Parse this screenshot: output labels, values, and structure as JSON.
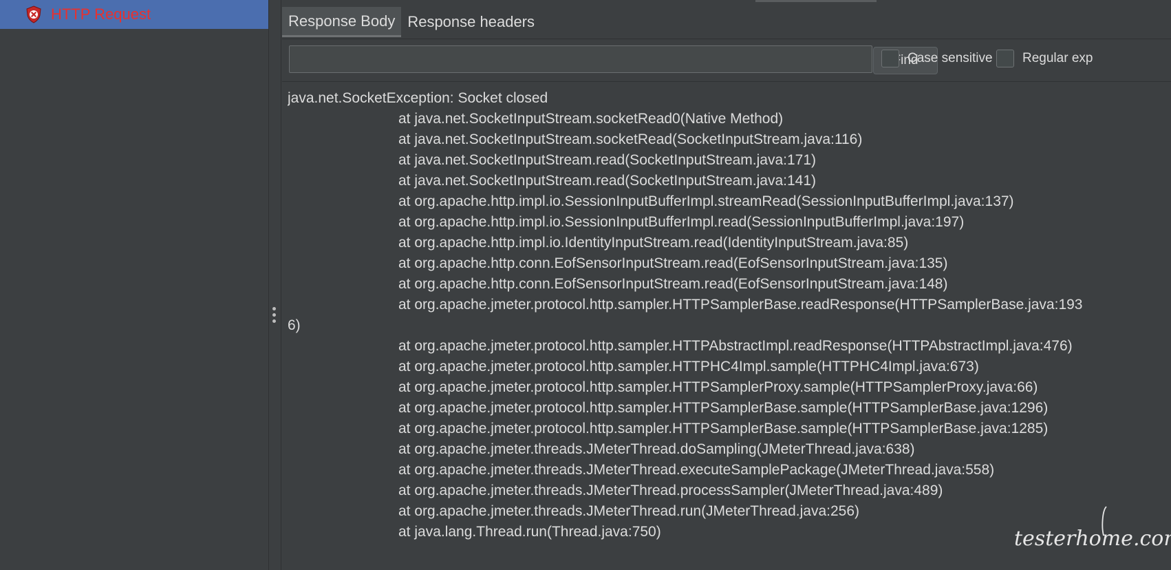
{
  "tree": {
    "selected_item": {
      "label": "HTTP Request",
      "icon": "error-shield-icon",
      "color": "#e8312f"
    }
  },
  "tabs": [
    {
      "label": "Response Body",
      "active": true
    },
    {
      "label": "Response headers",
      "active": false
    }
  ],
  "search": {
    "value": "",
    "find_label": "Find",
    "case_sensitive_label": "Case sensitive",
    "regex_label": "Regular exp",
    "case_sensitive_checked": false,
    "regex_checked": false
  },
  "response_body": {
    "lines": [
      {
        "text": "java.net.SocketException: Socket closed",
        "indent": false
      },
      {
        "text": "at java.net.SocketInputStream.socketRead0(Native Method)",
        "indent": true
      },
      {
        "text": "at java.net.SocketInputStream.socketRead(SocketInputStream.java:116)",
        "indent": true
      },
      {
        "text": "at java.net.SocketInputStream.read(SocketInputStream.java:171)",
        "indent": true
      },
      {
        "text": "at java.net.SocketInputStream.read(SocketInputStream.java:141)",
        "indent": true
      },
      {
        "text": "at org.apache.http.impl.io.SessionInputBufferImpl.streamRead(SessionInputBufferImpl.java:137)",
        "indent": true
      },
      {
        "text": "at org.apache.http.impl.io.SessionInputBufferImpl.read(SessionInputBufferImpl.java:197)",
        "indent": true
      },
      {
        "text": "at org.apache.http.impl.io.IdentityInputStream.read(IdentityInputStream.java:85)",
        "indent": true
      },
      {
        "text": "at org.apache.http.conn.EofSensorInputStream.read(EofSensorInputStream.java:135)",
        "indent": true
      },
      {
        "text": "at org.apache.http.conn.EofSensorInputStream.read(EofSensorInputStream.java:148)",
        "indent": true
      },
      {
        "text": "at org.apache.jmeter.protocol.http.sampler.HTTPSamplerBase.readResponse(HTTPSamplerBase.java:193",
        "indent": true
      },
      {
        "text": "6)",
        "indent": false
      },
      {
        "text": "at org.apache.jmeter.protocol.http.sampler.HTTPAbstractImpl.readResponse(HTTPAbstractImpl.java:476)",
        "indent": true
      },
      {
        "text": "at org.apache.jmeter.protocol.http.sampler.HTTPHC4Impl.sample(HTTPHC4Impl.java:673)",
        "indent": true
      },
      {
        "text": "at org.apache.jmeter.protocol.http.sampler.HTTPSamplerProxy.sample(HTTPSamplerProxy.java:66)",
        "indent": true
      },
      {
        "text": "at org.apache.jmeter.protocol.http.sampler.HTTPSamplerBase.sample(HTTPSamplerBase.java:1296)",
        "indent": true
      },
      {
        "text": "at org.apache.jmeter.protocol.http.sampler.HTTPSamplerBase.sample(HTTPSamplerBase.java:1285)",
        "indent": true
      },
      {
        "text": "at org.apache.jmeter.threads.JMeterThread.doSampling(JMeterThread.java:638)",
        "indent": true
      },
      {
        "text": "at org.apache.jmeter.threads.JMeterThread.executeSamplePackage(JMeterThread.java:558)",
        "indent": true
      },
      {
        "text": "at org.apache.jmeter.threads.JMeterThread.processSampler(JMeterThread.java:489)",
        "indent": true
      },
      {
        "text": "at org.apache.jmeter.threads.JMeterThread.run(JMeterThread.java:256)",
        "indent": true
      },
      {
        "text": "at java.lang.Thread.run(Thread.java:750)",
        "indent": true
      }
    ]
  },
  "watermark": {
    "text": "testerhome.com"
  }
}
